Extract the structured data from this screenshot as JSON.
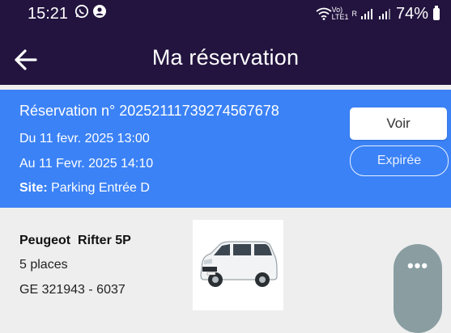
{
  "status_bar": {
    "time": "15:21",
    "network_label_top": "Vo)",
    "network_label_bottom": "LTE1",
    "signal_r": "R",
    "battery": "74%"
  },
  "app_bar": {
    "title": "Ma réservation",
    "background": "#22143f"
  },
  "reservation": {
    "number": "Réservation n° 20252111739274567678",
    "start": "Du 11 fevr. 2025 13:00",
    "end": "Au 11 Fevr. 2025 14:10",
    "site_label": "Site:",
    "site_value": " Parking Entrée D",
    "view_button": "Voir",
    "status_badge": "Expirée",
    "accent": "#3b82f6"
  },
  "vehicle": {
    "name": "Peugeot  Rifter 5P",
    "places": "5 places",
    "plate": "GE 321943 - 6037",
    "more_label": "•••"
  }
}
